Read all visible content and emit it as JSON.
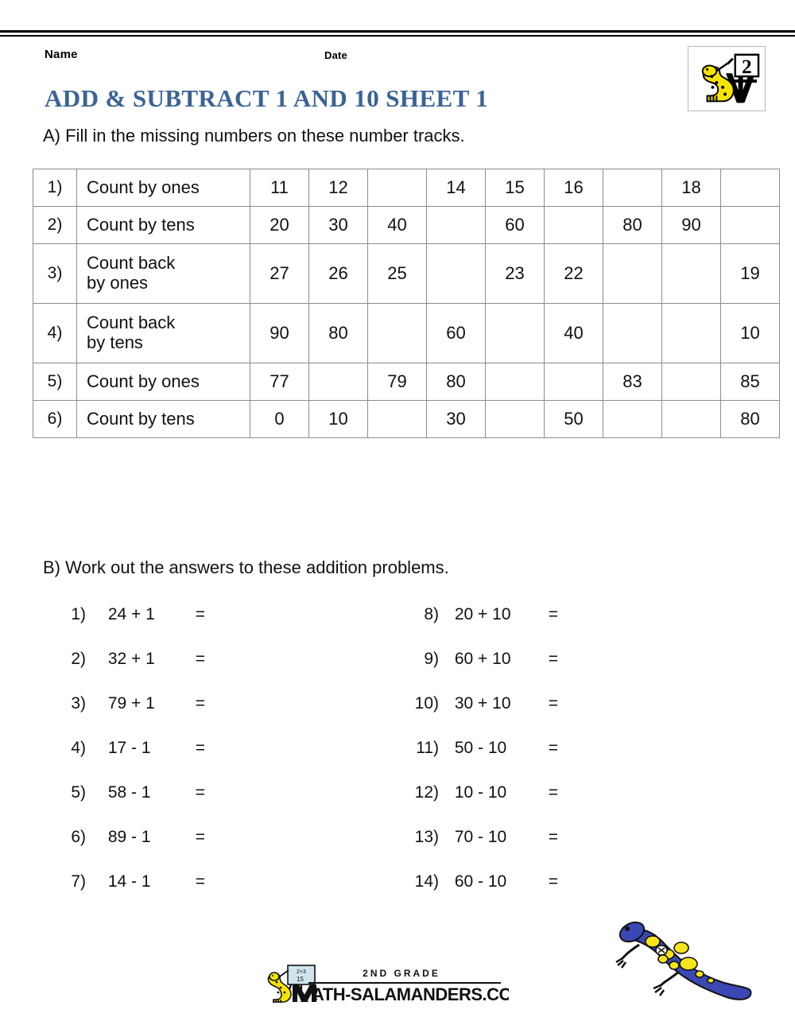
{
  "header": {
    "name_label": "Name",
    "date_label": "Date",
    "title": "ADD & SUBTRACT 1 AND 10 SHEET 1",
    "title_color": "#3a6395",
    "corner_logo": {
      "icon": "salamander-easel-grade-icon",
      "grade_number": "2"
    }
  },
  "section_a": {
    "instruction": "A) Fill in the missing numbers on these number tracks.",
    "rows": [
      {
        "index": "1)",
        "label_lines": [
          "Count by ones"
        ],
        "cells": [
          "11",
          "12",
          "",
          "14",
          "15",
          "16",
          "",
          "18",
          ""
        ]
      },
      {
        "index": "2)",
        "label_lines": [
          "Count by tens"
        ],
        "cells": [
          "20",
          "30",
          "40",
          "",
          "60",
          "",
          "80",
          "90",
          ""
        ]
      },
      {
        "index": "3)",
        "label_lines": [
          "Count back",
          "by ones"
        ],
        "cells": [
          "27",
          "26",
          "25",
          "",
          "23",
          "22",
          "",
          "",
          "19"
        ]
      },
      {
        "index": "4)",
        "label_lines": [
          "Count back",
          "by tens"
        ],
        "cells": [
          "90",
          "80",
          "",
          "60",
          "",
          "40",
          "",
          "",
          "10"
        ]
      },
      {
        "index": "5)",
        "label_lines": [
          "Count by ones"
        ],
        "cells": [
          "77",
          "",
          "79",
          "80",
          "",
          "",
          "83",
          "",
          "85"
        ]
      },
      {
        "index": "6)",
        "label_lines": [
          "Count by tens"
        ],
        "cells": [
          "0",
          "10",
          "",
          "30",
          "",
          "50",
          "",
          "",
          "80"
        ]
      }
    ]
  },
  "section_b": {
    "instruction": "B) Work out the answers to these addition problems.",
    "left_column": [
      {
        "index": "1)",
        "expression": "24 + 1",
        "equals": "=",
        "answer": ""
      },
      {
        "index": "2)",
        "expression": "32 + 1",
        "equals": "=",
        "answer": ""
      },
      {
        "index": "3)",
        "expression": "79 + 1",
        "equals": "=",
        "answer": ""
      },
      {
        "index": "4)",
        "expression": "17 - 1",
        "equals": "=",
        "answer": ""
      },
      {
        "index": "5)",
        "expression": "58 - 1",
        "equals": "=",
        "answer": ""
      },
      {
        "index": "6)",
        "expression": "89 - 1",
        "equals": "=",
        "answer": ""
      },
      {
        "index": "7)",
        "expression": "14 - 1",
        "equals": "=",
        "answer": ""
      }
    ],
    "right_column": [
      {
        "index": "8)",
        "expression": "20 + 10",
        "equals": "=",
        "answer": ""
      },
      {
        "index": "9)",
        "expression": "60 + 10",
        "equals": "=",
        "answer": ""
      },
      {
        "index": "10)",
        "expression": "30 + 10",
        "equals": "=",
        "answer": ""
      },
      {
        "index": "11)",
        "expression": "50 - 10",
        "equals": "=",
        "answer": ""
      },
      {
        "index": "12)",
        "expression": "10 - 10",
        "equals": "=",
        "answer": ""
      },
      {
        "index": "13)",
        "expression": "70 - 10",
        "equals": "=",
        "answer": ""
      },
      {
        "index": "14)",
        "expression": "60 - 10",
        "equals": "=",
        "answer": ""
      }
    ]
  },
  "footer": {
    "grade_text": "2ND GRADE",
    "site_text": "MATH-SALAMANDERS.COM",
    "logo_icon": "salamander-easel-icon",
    "decoration_icon": "blue-spotted-salamander-icon"
  },
  "colors": {
    "title_blue": "#3a6395",
    "table_border": "#8c8c8c",
    "salamander_blue": "#3a48b4",
    "salamander_spot_yellow": "#f5e51a",
    "mascot_yellow": "#f6e400"
  }
}
